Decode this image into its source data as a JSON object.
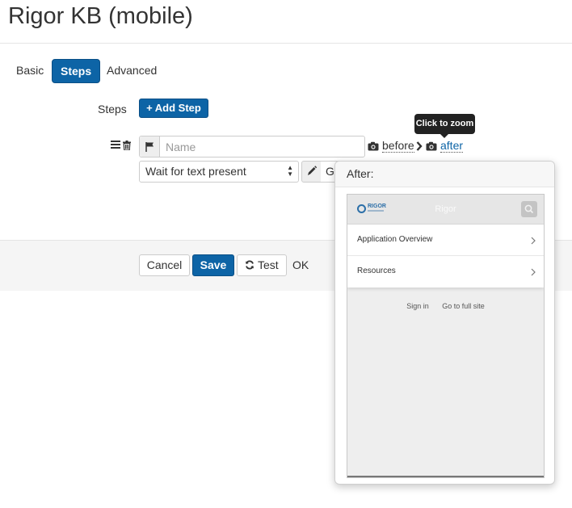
{
  "page": {
    "title": "Rigor KB (mobile)"
  },
  "tabs": [
    {
      "label": "Basic",
      "active": false
    },
    {
      "label": "Steps",
      "active": true
    },
    {
      "label": "Advanced",
      "active": false
    }
  ],
  "steps": {
    "label": "Steps",
    "add_button": "Add Step",
    "step": {
      "name_placeholder": "Name",
      "name_value": "",
      "action_selected": "Wait for text present",
      "value_text": "Go",
      "screenshot_before": "before",
      "screenshot_after": "after"
    }
  },
  "tooltip": {
    "text": "Click to zoom"
  },
  "popover": {
    "title": "After:",
    "preview": {
      "brand": "RIGOR",
      "header_title": "Rigor",
      "menu_items": [
        "Application Overview",
        "Resources"
      ],
      "footer_links": [
        "Sign in",
        "Go to full site"
      ]
    }
  },
  "actions": {
    "cancel": "Cancel",
    "save": "Save",
    "test": "Test",
    "status": "OK"
  },
  "colors": {
    "primary": "#0d64a6",
    "footer_bg": "#f5f5f5",
    "tooltip_bg": "#222222"
  },
  "icons": {
    "drag": "bars-icon",
    "delete": "trash-icon",
    "flag": "flag-icon",
    "camera": "camera-icon",
    "chevron": "chevron-right-icon",
    "pencil": "pencil-icon",
    "refresh": "refresh-icon",
    "plus": "plus-icon",
    "search": "search-icon"
  }
}
